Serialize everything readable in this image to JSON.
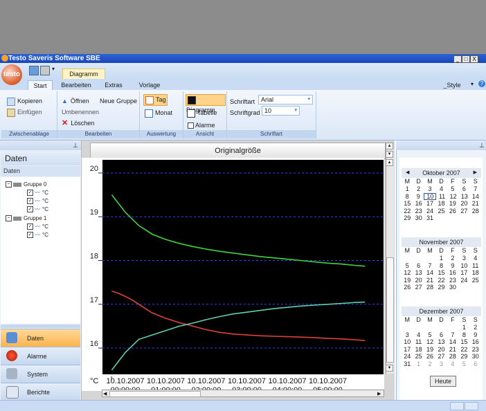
{
  "app": {
    "title": "Testo Saveris Software SBE",
    "orb_label": "testo"
  },
  "window_controls": [
    "_",
    "□",
    "X"
  ],
  "quick_access": {
    "active_doc": "Diagramm"
  },
  "tabs": [
    {
      "label": "Start",
      "active": true
    },
    {
      "label": "Bearbeiten"
    },
    {
      "label": "Extras"
    },
    {
      "label": "Vorlage"
    }
  ],
  "style_menu": "_Style",
  "ribbon": {
    "zwischenablage": {
      "label": "Zwischenablage",
      "kopieren": "Kopieren",
      "einfuegen": "Einfügen"
    },
    "bearbeiten": {
      "label": "Bearbeiten",
      "oeffnen": "Öffnen",
      "neue_gruppe": "Neue Gruppe",
      "umbenennen": "Umbenennen",
      "loeschen": "Löschen"
    },
    "auswertung": {
      "label": "Auswertung",
      "tag": "Tag",
      "monat": "Monat"
    },
    "ansicht": {
      "label": "Ansicht",
      "diagramm": "Diagramm",
      "tabelle": "Tabelle",
      "alarme": "Alarme"
    },
    "schriftart": {
      "label": "Schriftart",
      "font_label": "Schriftart",
      "font_value": "Arial",
      "size_label": "Schriftgrad",
      "size_value": "10"
    }
  },
  "left": {
    "header": "Daten",
    "subheader": "Daten",
    "tree": [
      {
        "group": "Gruppe 0",
        "channels": [
          "°C",
          "°C",
          "°C"
        ]
      },
      {
        "group": "Gruppe 1",
        "channels": [
          "°C",
          "°C"
        ]
      }
    ],
    "nav": [
      {
        "label": "Daten",
        "active": true
      },
      {
        "label": "Alarme"
      },
      {
        "label": "System"
      },
      {
        "label": "Berichte"
      }
    ]
  },
  "center": {
    "zoom_label": "Originalgröße"
  },
  "chart_data": {
    "type": "line",
    "ylim": [
      15.4,
      20.3
    ],
    "yticks": [
      "20",
      "19",
      "18",
      "17",
      "16"
    ],
    "ytick_values": [
      20,
      19,
      18,
      17,
      16
    ],
    "y_unit": "°C",
    "xticks": [
      {
        "date": "10.10.2007",
        "time": "00:00:00"
      },
      {
        "date": "10.10.2007",
        "time": "01:00:00"
      },
      {
        "date": "10.10.2007",
        "time": "02:00:00"
      },
      {
        "date": "10.10.2007",
        "time": "03:00:00"
      },
      {
        "date": "10.10.2007",
        "time": "04:00:00"
      },
      {
        "date": "10.10.2007",
        "time": "05:00:00"
      }
    ],
    "x": [
      "-00:20",
      "-00:10",
      "00:00",
      "00:10",
      "00:20",
      "00:40",
      "01:00",
      "01:20",
      "01:40",
      "02:00",
      "02:20",
      "02:40",
      "03:00",
      "03:20",
      "03:40",
      "04:00",
      "04:20",
      "04:40",
      "05:00",
      "05:20",
      "05:40",
      "05:55"
    ],
    "series": [
      {
        "color": "#3ed63e",
        "values": [
          19.5,
          19.3,
          19.1,
          18.95,
          18.8,
          18.6,
          18.48,
          18.39,
          18.32,
          18.26,
          18.21,
          18.17,
          18.13,
          18.09,
          18.06,
          18.03,
          18.0,
          17.97,
          17.94,
          17.92,
          17.89,
          17.87
        ]
      },
      {
        "color": "#e0403a",
        "values": [
          17.3,
          17.25,
          17.18,
          17.1,
          17.0,
          16.8,
          16.68,
          16.58,
          16.5,
          16.42,
          16.36,
          16.32,
          16.3,
          16.28,
          16.27,
          16.26,
          16.25,
          16.24,
          16.22,
          16.21,
          16.19,
          16.17
        ]
      },
      {
        "color": "#5fd0b0",
        "values": [
          15.5,
          15.7,
          15.9,
          16.05,
          16.2,
          16.3,
          16.4,
          16.5,
          16.57,
          16.65,
          16.72,
          16.78,
          16.82,
          16.86,
          16.9,
          16.93,
          16.96,
          16.98,
          17.0,
          17.02,
          17.04,
          17.05
        ]
      }
    ],
    "grid": true
  },
  "calendar": {
    "weekdays": [
      "M",
      "D",
      "M",
      "D",
      "F",
      "S",
      "S"
    ],
    "months": [
      {
        "name": "Oktober 2007",
        "rows": [
          [
            "1",
            "2",
            "3",
            "4",
            "5",
            "6",
            "7"
          ],
          [
            "8",
            "9",
            "10",
            "11",
            "12",
            "13",
            "14"
          ],
          [
            "15",
            "16",
            "17",
            "18",
            "19",
            "20",
            "21"
          ],
          [
            "22",
            "23",
            "24",
            "25",
            "26",
            "27",
            "28"
          ],
          [
            "29",
            "30",
            "31",
            "",
            "",
            "",
            ""
          ]
        ],
        "selected": "10"
      },
      {
        "name": "November 2007",
        "rows": [
          [
            "",
            "",
            "",
            "1",
            "2",
            "3",
            "4"
          ],
          [
            "5",
            "6",
            "7",
            "8",
            "9",
            "10",
            "11"
          ],
          [
            "12",
            "13",
            "14",
            "15",
            "16",
            "17",
            "18"
          ],
          [
            "19",
            "20",
            "21",
            "22",
            "23",
            "24",
            "25"
          ],
          [
            "26",
            "27",
            "28",
            "29",
            "30",
            "",
            ""
          ]
        ]
      },
      {
        "name": "Dezember 2007",
        "rows": [
          [
            "",
            "",
            "",
            "",
            "",
            "1",
            "2"
          ],
          [
            "3",
            "4",
            "5",
            "6",
            "7",
            "8",
            "9"
          ],
          [
            "10",
            "11",
            "12",
            "13",
            "14",
            "15",
            "16"
          ],
          [
            "17",
            "18",
            "19",
            "20",
            "21",
            "22",
            "23"
          ],
          [
            "24",
            "25",
            "26",
            "27",
            "28",
            "29",
            "30"
          ],
          [
            "31",
            "1",
            "2",
            "3",
            "4",
            "5",
            "6"
          ]
        ]
      }
    ],
    "today_button": "Heute"
  }
}
